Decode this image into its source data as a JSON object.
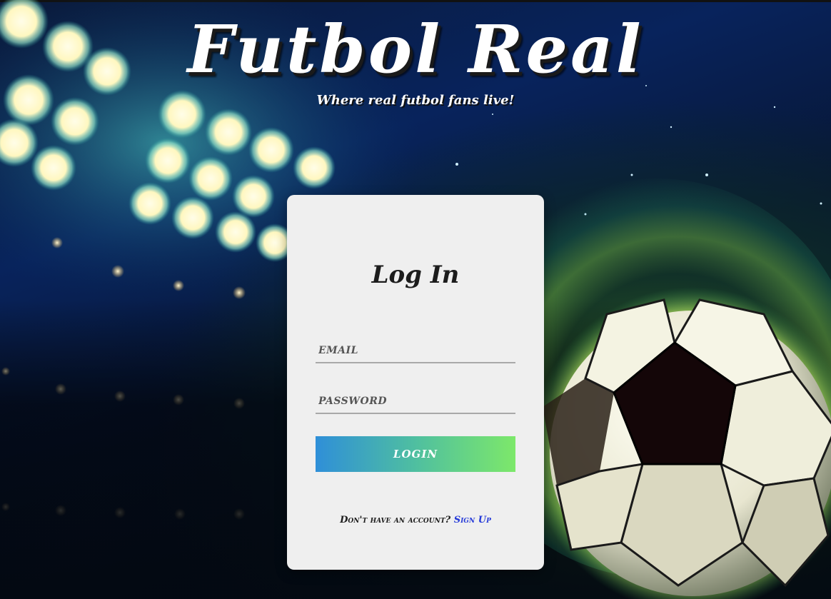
{
  "header": {
    "title": "Futbol Real",
    "subtitle": "Where real futbol fans live!"
  },
  "login": {
    "heading": "Log In",
    "email_placeholder": "EMAIL",
    "password_placeholder": "PASSWORD",
    "button_label": "LOGIN",
    "signup_prompt": "Don't have an account?",
    "signup_link": "Sign Up"
  },
  "colors": {
    "card_background": "#efefef",
    "button_gradient_start": "#2f8fd8",
    "button_gradient_end": "#7de86a",
    "link": "#2439d8"
  }
}
